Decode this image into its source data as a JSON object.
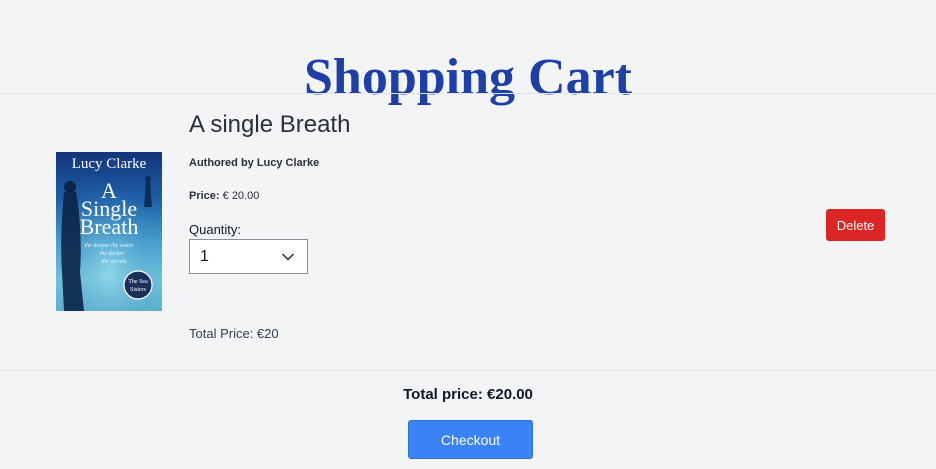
{
  "header": {
    "title": "Shopping Cart"
  },
  "cart_item": {
    "cover": {
      "author": "Lucy Clarke",
      "title_line1": "A",
      "title_line2": "Single",
      "title_line3": "Breath"
    },
    "title": "A single Breath",
    "author_line": "Authored by Lucy Clarke",
    "price_label": "Price:",
    "price_value": "€ 20.00",
    "quantity_label": "Quantity:",
    "quantity_value": "1",
    "item_total": "Total Price: €20",
    "delete_label": "Delete"
  },
  "summary": {
    "total_price": "Total price: €20.00",
    "checkout_label": "Checkout"
  },
  "colors": {
    "title": "#1f3fa8",
    "delete": "#dc2626",
    "checkout": "#3b82f6",
    "background": "#f3f4f6"
  },
  "icons": {
    "quantity_dropdown": "chevron-down-icon"
  }
}
